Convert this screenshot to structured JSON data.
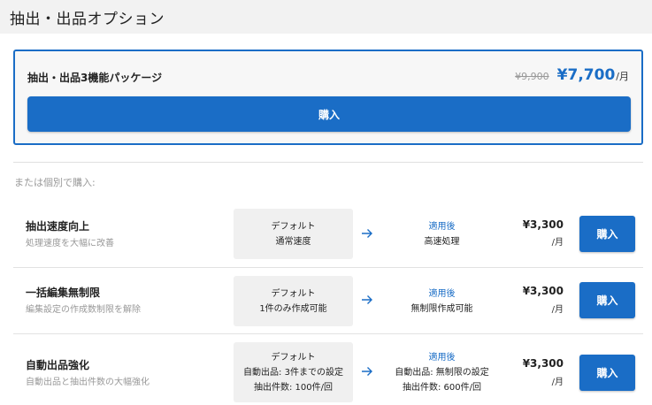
{
  "header": {
    "title": "抽出・出品オプション"
  },
  "package": {
    "name": "抽出・出品3機能パッケージ",
    "price_old": "¥9,900",
    "price_new": "¥7,700",
    "price_unit": "/月",
    "buy_label": "購入"
  },
  "individual_label": "または個別で購入:",
  "arrow_icon": "arrow-right-icon",
  "accent_color": "#1a6dc6",
  "options": [
    {
      "name": "抽出速度向上",
      "description": "処理速度を大幅に改善",
      "default_head": "デフォルト",
      "default_lines": [
        "通常速度"
      ],
      "after_head": "適用後",
      "after_lines": [
        "高速処理"
      ],
      "price": "¥3,300",
      "unit": "/月",
      "buy_label": "購入"
    },
    {
      "name": "一括編集無制限",
      "description": "編集設定の作成数制限を解除",
      "default_head": "デフォルト",
      "default_lines": [
        "1件のみ作成可能"
      ],
      "after_head": "適用後",
      "after_lines": [
        "無制限作成可能"
      ],
      "price": "¥3,300",
      "unit": "/月",
      "buy_label": "購入"
    },
    {
      "name": "自動出品強化",
      "description": "自動出品と抽出件数の大幅強化",
      "default_head": "デフォルト",
      "default_lines": [
        "自動出品: 3件までの設定",
        "抽出件数: 100件/回"
      ],
      "after_head": "適用後",
      "after_lines": [
        "自動出品: 無制限の設定",
        "抽出件数: 600件/回"
      ],
      "price": "¥3,300",
      "unit": "/月",
      "buy_label": "購入"
    }
  ]
}
